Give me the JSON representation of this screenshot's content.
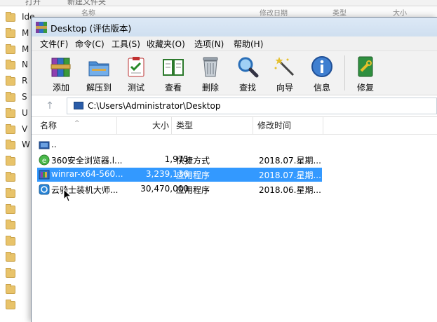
{
  "background_window": {
    "top_items": [
      "打开",
      "新建文件夹"
    ],
    "columns": [
      "名称",
      "修改日期",
      "类型",
      "大小"
    ],
    "folders": [
      "Ide",
      "M",
      "M",
      "N",
      "R",
      "S",
      "U",
      "V",
      "W",
      "",
      "",
      "",
      "",
      "",
      "",
      "",
      "",
      "",
      ""
    ]
  },
  "window": {
    "title": "Desktop (评估版本)"
  },
  "menu": [
    "文件(F)",
    "命令(C)",
    "工具(S)",
    "收藏夹(O)",
    "选项(N)",
    "帮助(H)"
  ],
  "toolbar": [
    {
      "label": "添加",
      "icon": "add-archive-icon"
    },
    {
      "label": "解压到",
      "icon": "extract-to-icon"
    },
    {
      "label": "测试",
      "icon": "test-icon"
    },
    {
      "label": "查看",
      "icon": "view-icon"
    },
    {
      "label": "删除",
      "icon": "delete-icon"
    },
    {
      "label": "查找",
      "icon": "find-icon"
    },
    {
      "label": "向导",
      "icon": "wizard-icon"
    },
    {
      "label": "信息",
      "icon": "info-icon"
    },
    {
      "label": "修复",
      "icon": "repair-icon"
    }
  ],
  "address": {
    "path": "C:\\Users\\Administrator\\Desktop"
  },
  "columns": {
    "name": "名称",
    "size": "大小",
    "type": "类型",
    "modified": "修改时间"
  },
  "files": [
    {
      "name": "..",
      "size": "",
      "type": "",
      "modified": "",
      "icon": "parent-folder-icon",
      "selected": false
    },
    {
      "name": "360安全浏览器.l...",
      "size": "1,975",
      "type": "快捷方式",
      "modified": "2018.07.星期...",
      "icon": "browser-shortcut-icon",
      "selected": false
    },
    {
      "name": "winrar-x64-560...",
      "size": "3,239,136",
      "type": "应用程序",
      "modified": "2018.07.星期...",
      "icon": "winrar-installer-icon",
      "selected": true
    },
    {
      "name": "云骑士装机大师...",
      "size": "30,470,000",
      "type": "应用程序",
      "modified": "2018.06.星期...",
      "icon": "app-installer-icon",
      "selected": false
    }
  ],
  "colors": {
    "selection": "#3399ff",
    "titlebar": "#dde9f6"
  }
}
